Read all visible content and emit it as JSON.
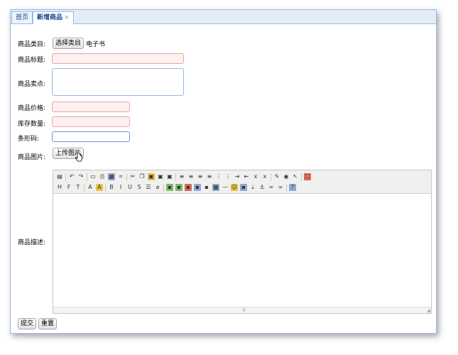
{
  "tabs": [
    {
      "label": "首页",
      "active": false
    },
    {
      "label": "新增商品",
      "active": true,
      "close": "×"
    }
  ],
  "form": {
    "category_label": "商品类目:",
    "category_button": "选择类目",
    "category_value": "电子书",
    "title_label": "商品标题:",
    "title_value": "",
    "selling_point_label": "商品卖点:",
    "selling_point_value": "",
    "price_label": "商品价格:",
    "price_value": "",
    "stock_label": "库存数量:",
    "stock_value": "",
    "barcode_label": "条形码:",
    "barcode_value": "",
    "image_label": "商品图片:",
    "upload_button": "上传图片",
    "description_label": "商品描述:",
    "description_value": ""
  },
  "toolbar_row1": [
    "source-icon",
    "undo-icon",
    "redo-icon",
    "preview-icon",
    "print-icon",
    "template-icon",
    "code-icon",
    "cut-icon",
    "copy-icon",
    "paste-icon",
    "paste-text-icon",
    "paste-word-icon",
    "align-left-icon",
    "align-center-icon",
    "align-right-icon",
    "align-justify-icon",
    "ordered-list-icon",
    "unordered-list-icon",
    "indent-icon",
    "outdent-icon",
    "subscript-icon",
    "superscript-icon",
    "clear-format-icon",
    "select-all-icon",
    "cursor-icon",
    "fullscreen-icon"
  ],
  "toolbar_row2": [
    "heading-icon",
    "font-family-icon",
    "font-size-icon",
    "font-color-icon",
    "highlight-color-icon",
    "bold-icon",
    "italic-icon",
    "underline-icon",
    "strikethrough-icon",
    "line-height-icon",
    "remove-format-icon",
    "image-icon",
    "multi-image-icon",
    "flash-icon",
    "media-icon",
    "file-icon",
    "table-icon",
    "horizontal-rule-icon",
    "emoticon-icon",
    "baidu-map-icon",
    "page-break-icon",
    "anchor-icon",
    "link-icon",
    "unlink-icon",
    "about-icon"
  ],
  "buttons": {
    "submit": "提交",
    "reset": "重置"
  }
}
